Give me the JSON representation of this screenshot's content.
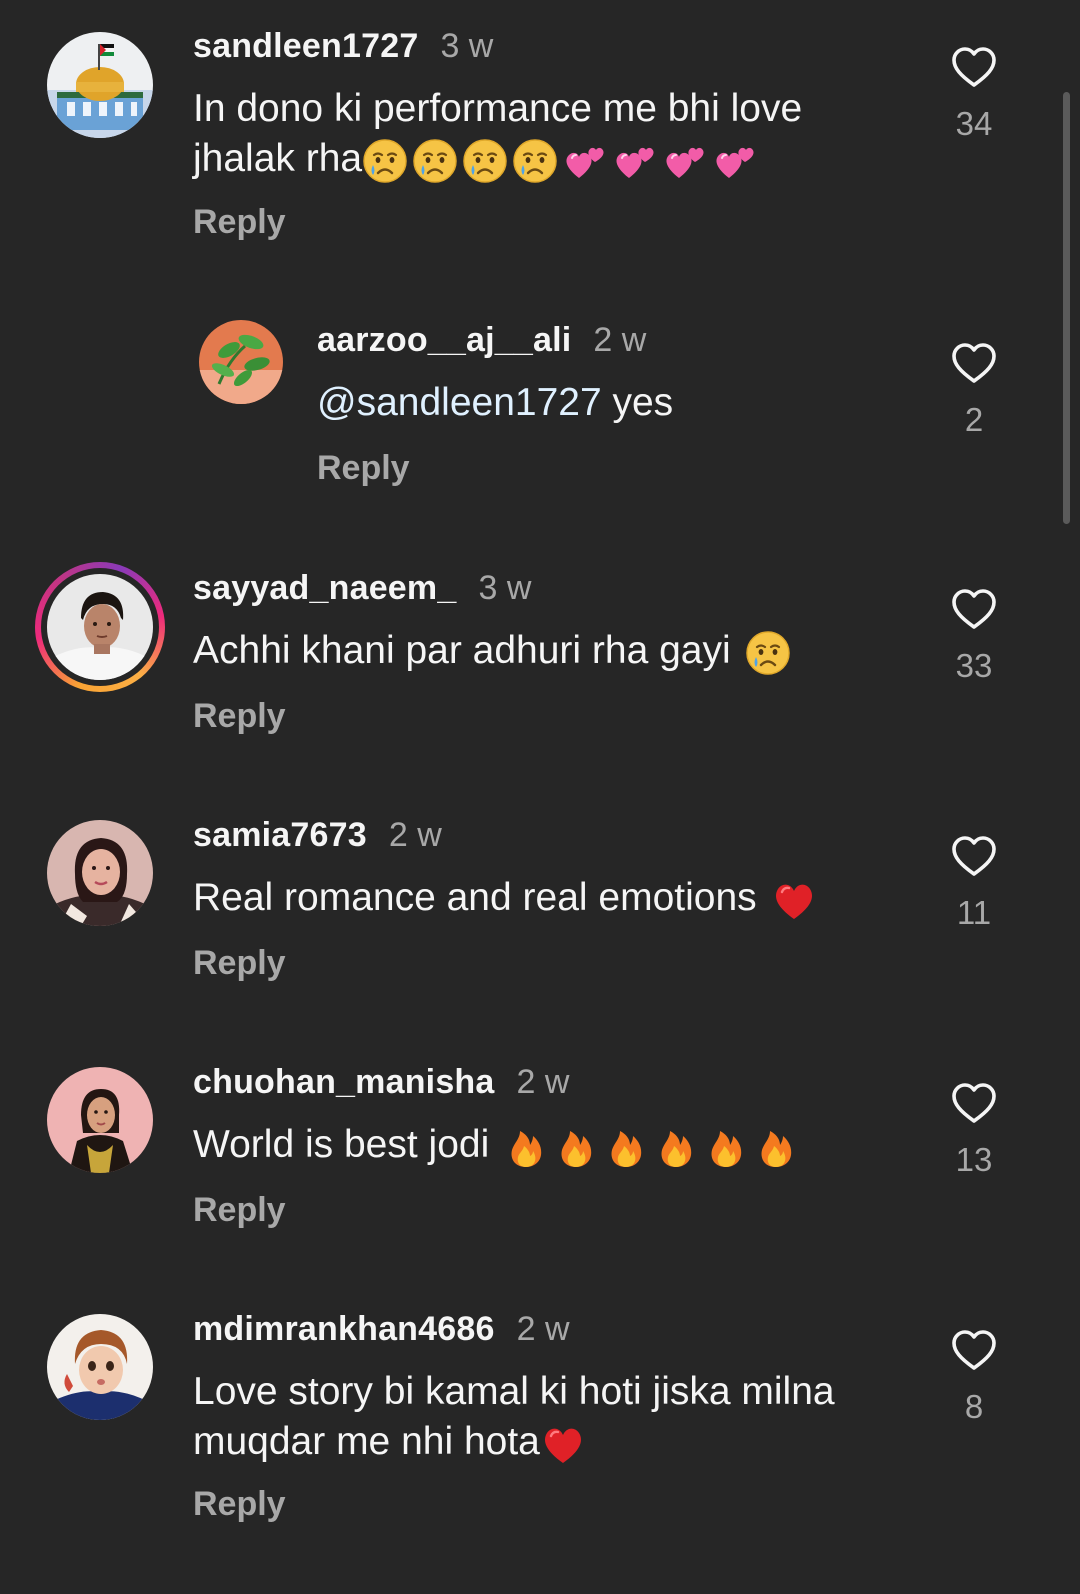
{
  "comments": [
    {
      "username": "sandleen1727",
      "time": "3 w",
      "text_line1": "In dono ki performance me bhi love",
      "text_line2": "jhalak rha",
      "reply_label": "Reply",
      "likes": "34",
      "emojis": [
        "crying-face-icon",
        "crying-face-icon",
        "crying-face-icon",
        "crying-face-icon",
        "two-hearts-icon",
        "two-hearts-icon",
        "two-hearts-icon",
        "two-hearts-icon"
      ]
    },
    {
      "username": "aarzoo__aj__ali",
      "time": "2 w",
      "mention": "@sandleen1727",
      "text": " yes",
      "reply_label": "Reply",
      "likes": "2",
      "is_reply": true
    },
    {
      "username": "sayyad_naeem_",
      "time": "3 w",
      "text": "Achhi khani par adhuri rha gayi",
      "reply_label": "Reply",
      "likes": "33",
      "has_story": true,
      "emojis": [
        "crying-face-icon"
      ]
    },
    {
      "username": "samia7673",
      "time": "2 w",
      "text": "Real romance and real emotions",
      "reply_label": "Reply",
      "likes": "11",
      "emojis": [
        "red-heart-icon"
      ]
    },
    {
      "username": "chuohan_manisha",
      "time": "2 w",
      "text": "World is best jodi",
      "reply_label": "Reply",
      "likes": "13",
      "emojis": [
        "fire-icon",
        "fire-icon",
        "fire-icon",
        "fire-icon",
        "fire-icon",
        "fire-icon"
      ]
    },
    {
      "username": "mdimrankhan4686",
      "time": "2 w",
      "text_line1": "Love story bi kamal ki hoti jiska milna",
      "text_line2": "muqdar me nhi hota",
      "reply_label": "Reply",
      "likes": "8",
      "emojis": [
        "red-heart-icon"
      ]
    }
  ],
  "colors": {
    "background": "#262626",
    "primary_text": "#f5f5f5",
    "secondary_text": "#a8a8a8",
    "mention": "#e0f1ff"
  }
}
